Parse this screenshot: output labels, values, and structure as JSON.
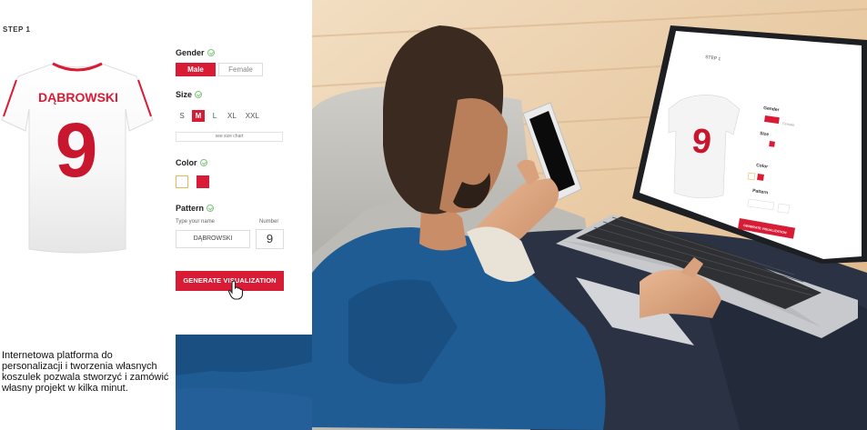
{
  "panel": {
    "step_label": "STEP 1",
    "shirt": {
      "name": "DĄBROWSKI",
      "number": "9"
    },
    "gender": {
      "title": "Gender",
      "options": [
        "Male",
        "Female"
      ],
      "selected": "Male"
    },
    "size": {
      "title": "Size",
      "options": [
        "S",
        "M",
        "L",
        "XL",
        "XXL"
      ],
      "selected": "M",
      "chart_link": "see size chart"
    },
    "color": {
      "title": "Color",
      "swatches": [
        "#ffffff",
        "#d91c35"
      ]
    },
    "pattern": {
      "title": "Pattern",
      "name_label": "Type your name",
      "number_label": "Number",
      "name_value": "DĄBROWSKI",
      "number_value": "9"
    },
    "generate_label": "GENERATE VISUALIZATION"
  },
  "caption": "Internetowa platforma do personalizacji i tworzenia własnych koszulek pozwala stworzyć i zamówić własny projekt w kilka minut.",
  "laptop_screen": {
    "step_label": "STEP 1",
    "gender": "Gender",
    "size": "Size",
    "color": "Color",
    "pattern": "Pattern",
    "male": "Male",
    "female": "Female",
    "number": "9",
    "generate_label": "GENERATE VISUALIZATION"
  },
  "colors": {
    "accent": "#d91c35",
    "wood": "#e7c79f",
    "shirt_blue": "#1f5c94"
  },
  "icons": [
    "check-icon",
    "hand-pointer-icon"
  ]
}
